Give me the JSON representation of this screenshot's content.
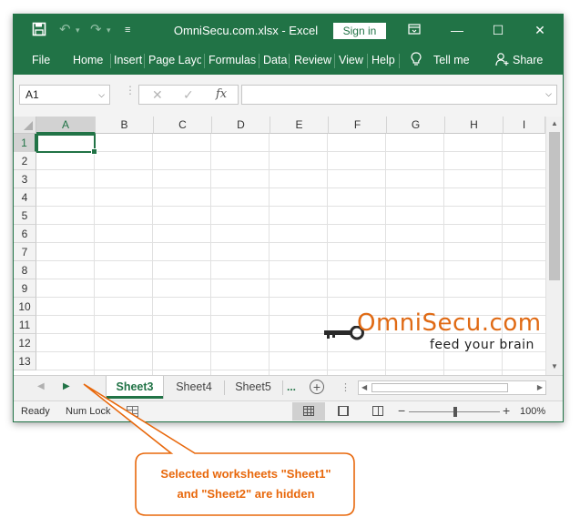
{
  "window": {
    "title": "OmniSecu.com.xlsx  -  Excel",
    "sign_in": "Sign in",
    "colors": {
      "excel_green": "#217346",
      "callout_orange": "#e8680c"
    }
  },
  "quick_access": {
    "icons": [
      "save-icon",
      "undo-icon",
      "redo-icon",
      "customize-icon"
    ],
    "customize_glyph": "≡"
  },
  "window_controls": {
    "ribbon_options": "☐",
    "minimize": "—",
    "maximize": "☐",
    "close": "✕"
  },
  "ribbon": {
    "tabs": [
      "File",
      "Home",
      "Insert",
      "Page Layou",
      "Formulas",
      "Data",
      "Review",
      "View",
      "Help"
    ],
    "tell_me": "Tell me",
    "share": "Share"
  },
  "formula_bar": {
    "name_box": "A1",
    "cancel_glyph": "✕",
    "enter_glyph": "✓",
    "fx_label": "fx",
    "value": ""
  },
  "grid": {
    "columns": [
      "A",
      "B",
      "C",
      "D",
      "E",
      "F",
      "G",
      "H",
      "I"
    ],
    "rows": [
      "1",
      "2",
      "3",
      "4",
      "5",
      "6",
      "7",
      "8",
      "9",
      "10",
      "11",
      "12",
      "13"
    ],
    "selected_cell": "A1"
  },
  "logo": {
    "text": "OmniSecu.com",
    "tagline": "feed your brain"
  },
  "sheets": {
    "tabs": [
      "Sheet3",
      "Sheet4",
      "Sheet5"
    ],
    "active": "Sheet3",
    "more": "...",
    "add": "+"
  },
  "status": {
    "ready": "Ready",
    "num_lock": "Num Lock",
    "zoom": "100%",
    "zoom_minus": "−",
    "zoom_plus": "+"
  },
  "callout": {
    "line1": "Selected worksheets \"Sheet1\"",
    "line2": "and \"Sheet2\" are hidden"
  }
}
